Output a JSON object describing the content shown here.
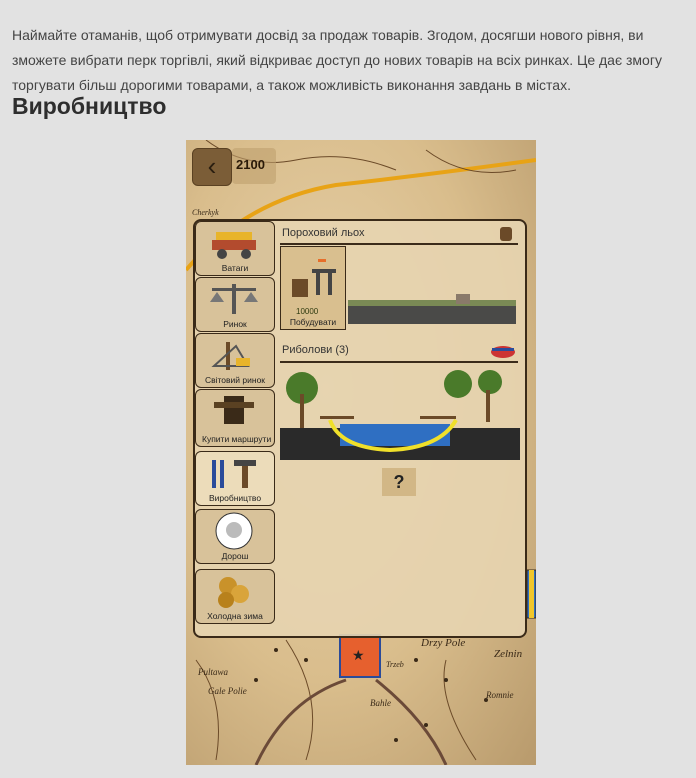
{
  "article": {
    "intro": "Наймайте отаманів, щоб отримувати досвід за продаж товарів. Згодом, досягши нового рівня, ви зможете вибрати перк торгівлі, який відкриває доступ до нових товарів на всіх ринках. Це дає змогу торгувати більш дорогими товарами, а також можливість виконання завдань в містах.",
    "heading": "Виробництво"
  },
  "game": {
    "coins": "2100",
    "sidebar": [
      {
        "label": "Ватаги",
        "icon": "cart-icon"
      },
      {
        "label": "Ринок",
        "icon": "scales-icon"
      },
      {
        "label": "Світовий ринок",
        "icon": "world-scales-icon"
      },
      {
        "label": "Купити маршрути",
        "icon": "route-icon"
      },
      {
        "label": "Виробництво",
        "icon": "tools-icon"
      },
      {
        "label": "Дорош",
        "icon": "portrait-icon"
      },
      {
        "label": "Холодна зима",
        "icon": "coins-icon"
      }
    ],
    "sections": {
      "powder": {
        "title": "Пороховий льох"
      },
      "build": {
        "cost": "10000",
        "label": "Побудувати"
      },
      "fishers": {
        "title": "Риболови (3)"
      },
      "help": "?"
    },
    "map_labels": [
      "Drzy Pole",
      "Zelnin",
      "Pultawa",
      "Gale Polie",
      "Romnie",
      "Cherkyk",
      "Bahle",
      "Trzeb"
    ]
  }
}
